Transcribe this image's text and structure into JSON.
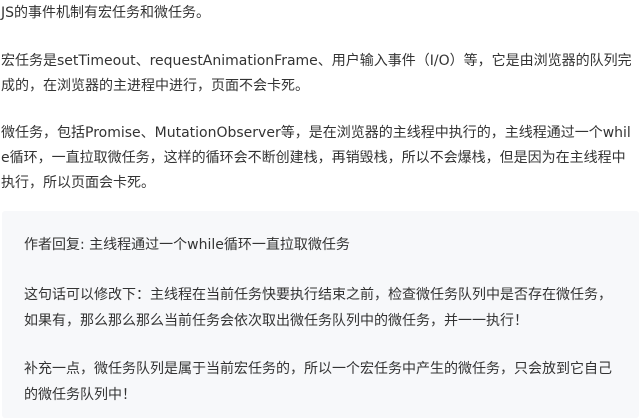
{
  "comment": {
    "paragraphs": [
      "JS的事件机制有宏任务和微任务。",
      "宏任务是setTimeout、requestAnimationFrame、用户输入事件（I/O）等，它是由浏览器的队列完成的，在浏览器的主进程中进行，页面不会卡死。",
      "微任务，包括Promise、MutationObserver等，是在浏览器的主线程中执行的，主线程通过一个while循环，一直拉取微任务，这样的循环会不断创建栈，再销毁栈，所以不会爆栈，但是因为在主线程中执行，所以页面会卡死。"
    ]
  },
  "reply": {
    "header": "作者回复: 主线程通过一个while循环一直拉取微任务",
    "paragraphs": [
      "这句话可以修改下：主线程在当前任务快要执行结束之前，检查微任务队列中是否存在微任务，如果有，那么那么那么当前任务会依次取出微任务队列中的微任务，并一一执行！",
      "补充一点，微任务队列是属于当前宏任务的，所以一个宏任务中产生的微任务，只会放到它自己的微任务队列中！"
    ]
  },
  "colors": {
    "text": "#333333",
    "reply_background": "#f7f8fa",
    "page_background": "#ffffff"
  }
}
